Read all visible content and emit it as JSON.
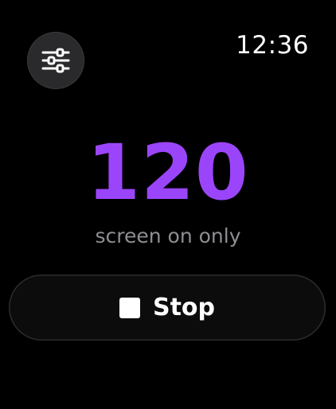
{
  "status_bar": {
    "time": "12:36"
  },
  "settings_button": {
    "icon": "sliders-icon"
  },
  "main": {
    "value": "120",
    "subtitle": "screen on only"
  },
  "stop_button": {
    "icon": "stop-icon",
    "label": "Stop"
  },
  "colors": {
    "background": "#000000",
    "accent": "#9b45fb",
    "subtitle": "#8e8e93",
    "button_bg": "#0c0c0c",
    "settings_bg": "#2a2a2c"
  }
}
